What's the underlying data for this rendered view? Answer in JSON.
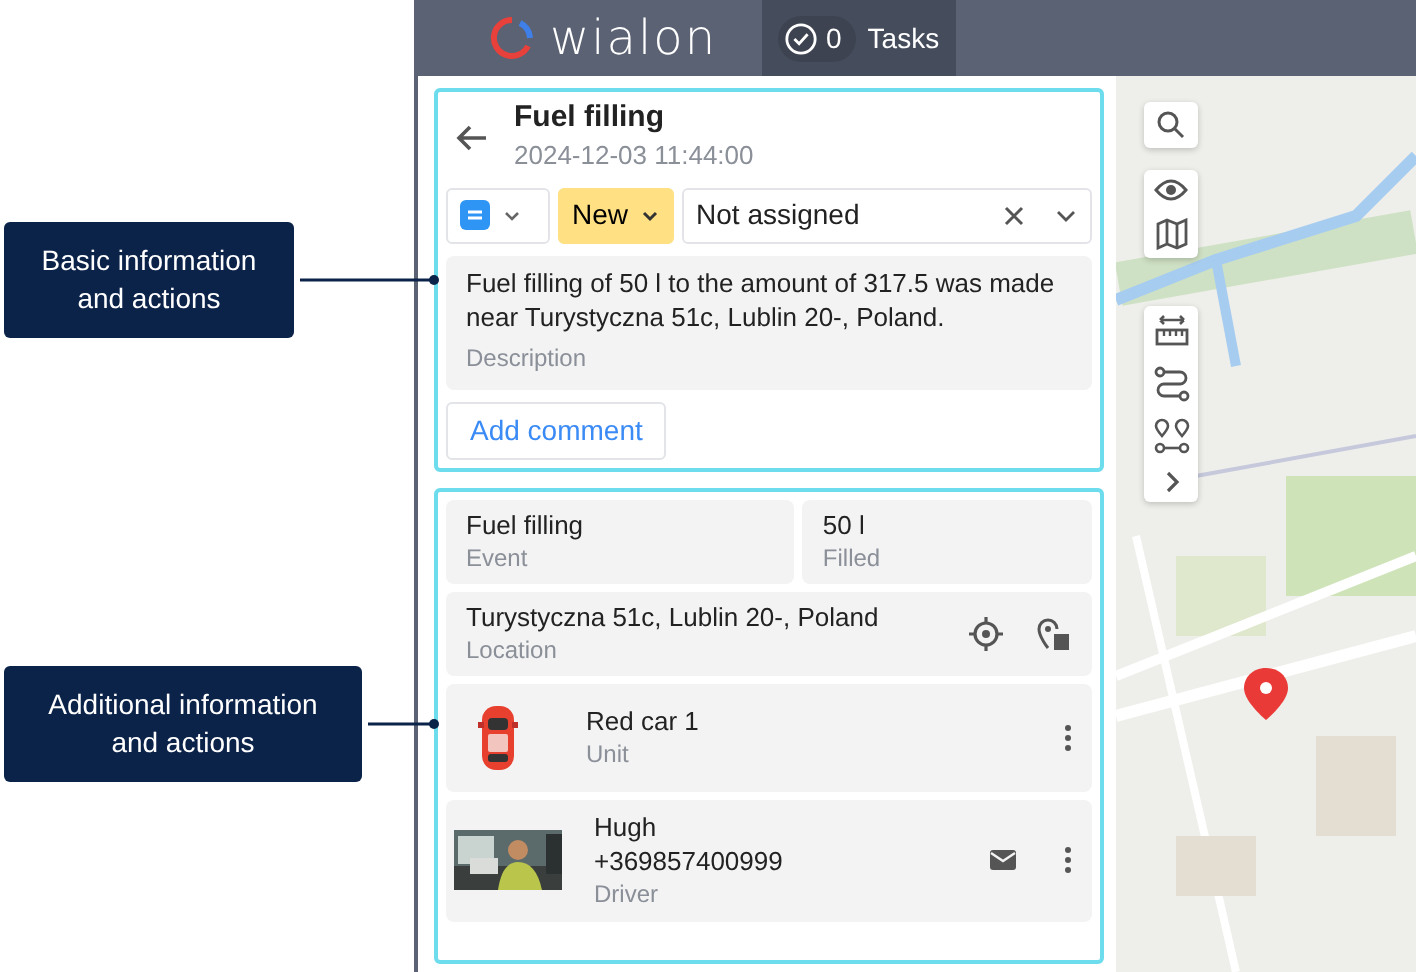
{
  "header": {
    "logo": "wialon",
    "tasks_count": "0",
    "tasks_label": "Tasks"
  },
  "task": {
    "title": "Fuel filling",
    "datetime": "2024-12-03 11:44:00",
    "status": "New",
    "assignee": "Not assigned",
    "description": "Fuel filling of 50 l to the amount of 317.5 was made near Turystyczna 51c, Lublin 20-, Poland.",
    "description_label": "Description",
    "add_comment": "Add comment"
  },
  "details": {
    "fields": [
      {
        "value": "Fuel filling",
        "label": "Event"
      },
      {
        "value": "50 l",
        "label": "Filled"
      }
    ],
    "location": {
      "value": "Turystyczna 51c, Lublin 20-, Poland",
      "label": "Location"
    },
    "unit": {
      "name": "Red car 1",
      "label": "Unit"
    },
    "driver": {
      "name": "Hugh",
      "phone": "+369857400999",
      "label": "Driver"
    }
  },
  "callouts": [
    {
      "text": "Basic information and actions"
    },
    {
      "text": "Additional information and actions"
    }
  ]
}
